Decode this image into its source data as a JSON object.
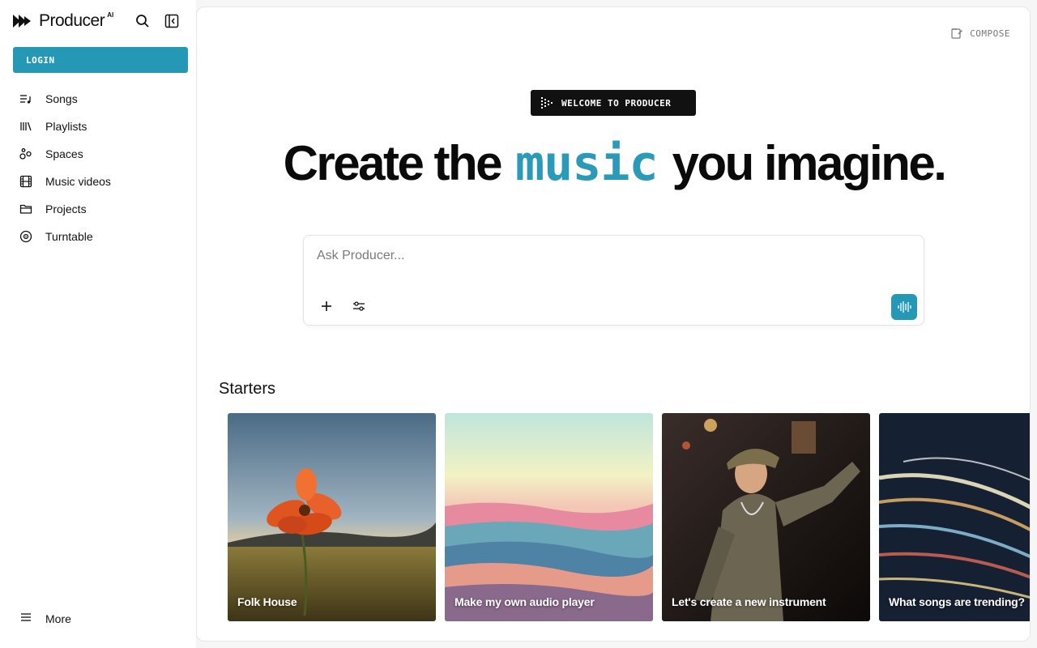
{
  "brand": {
    "name": "Producer",
    "sup": "AI"
  },
  "sidebar": {
    "login_label": "LOGIN",
    "items": [
      {
        "label": "Songs",
        "icon": "songs-icon"
      },
      {
        "label": "Playlists",
        "icon": "playlists-icon"
      },
      {
        "label": "Spaces",
        "icon": "spaces-icon"
      },
      {
        "label": "Music videos",
        "icon": "film-icon"
      },
      {
        "label": "Projects",
        "icon": "folder-icon"
      },
      {
        "label": "Turntable",
        "icon": "turntable-icon"
      }
    ],
    "more_label": "More"
  },
  "main": {
    "compose_label": "COMPOSE",
    "welcome_label": "WELCOME TO PRODUCER",
    "headline": {
      "before": "Create the",
      "accent": "music",
      "after": "you imagine."
    },
    "prompt": {
      "placeholder": "Ask Producer..."
    },
    "starters_title": "Starters",
    "starters": [
      {
        "label": "Folk House"
      },
      {
        "label": "Make my own audio player"
      },
      {
        "label": "Let's create a new instrument"
      },
      {
        "label": "What songs are trending?"
      }
    ]
  },
  "colors": {
    "accent": "#2598b6",
    "headline_accent": "#2a9ab8",
    "welcome_bg": "#111111"
  }
}
